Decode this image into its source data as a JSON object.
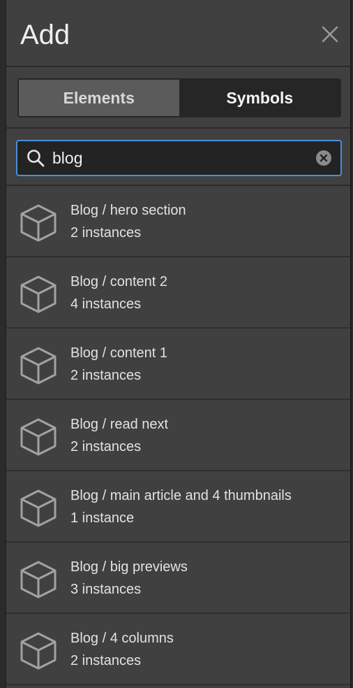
{
  "panel": {
    "title": "Add",
    "close_icon": "close-icon"
  },
  "tabs": [
    {
      "label": "Elements",
      "selected": false
    },
    {
      "label": "Symbols",
      "selected": true
    }
  ],
  "search": {
    "value": "blog",
    "icon": "search-icon",
    "clear_icon": "clear-icon"
  },
  "symbols": [
    {
      "name": "Blog / hero section",
      "count": "2 instances",
      "icon": "cube-icon"
    },
    {
      "name": "Blog / content 2",
      "count": "4 instances",
      "icon": "cube-icon"
    },
    {
      "name": "Blog / content 1",
      "count": "2 instances",
      "icon": "cube-icon"
    },
    {
      "name": "Blog / read next",
      "count": "2 instances",
      "icon": "cube-icon"
    },
    {
      "name": "Blog / main article and 4 thumbnails",
      "count": "1 instance",
      "icon": "cube-icon"
    },
    {
      "name": "Blog / big previews",
      "count": "3 instances",
      "icon": "cube-icon"
    },
    {
      "name": "Blog / 4 columns",
      "count": "2 instances",
      "icon": "cube-icon"
    }
  ],
  "colors": {
    "panel_bg": "#404040",
    "active_tab_bg": "#262626",
    "inactive_tab_bg": "#5b5b5b",
    "focus_border": "#4a8fd8"
  }
}
